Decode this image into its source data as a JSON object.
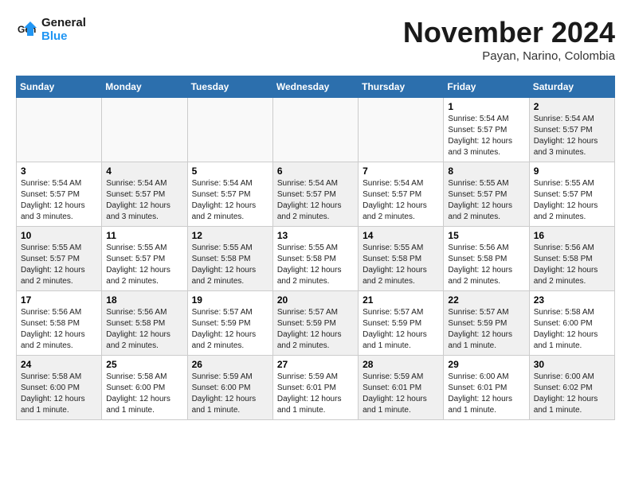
{
  "logo": {
    "line1": "General",
    "line2": "Blue"
  },
  "title": "November 2024",
  "location": "Payan, Narino, Colombia",
  "days_of_week": [
    "Sunday",
    "Monday",
    "Tuesday",
    "Wednesday",
    "Thursday",
    "Friday",
    "Saturday"
  ],
  "weeks": [
    [
      {
        "day": "",
        "info": "",
        "empty": true
      },
      {
        "day": "",
        "info": "",
        "empty": true
      },
      {
        "day": "",
        "info": "",
        "empty": true
      },
      {
        "day": "",
        "info": "",
        "empty": true
      },
      {
        "day": "",
        "info": "",
        "empty": true
      },
      {
        "day": "1",
        "info": "Sunrise: 5:54 AM\nSunset: 5:57 PM\nDaylight: 12 hours\nand 3 minutes."
      },
      {
        "day": "2",
        "info": "Sunrise: 5:54 AM\nSunset: 5:57 PM\nDaylight: 12 hours\nand 3 minutes.",
        "shaded": true
      }
    ],
    [
      {
        "day": "3",
        "info": "Sunrise: 5:54 AM\nSunset: 5:57 PM\nDaylight: 12 hours\nand 3 minutes."
      },
      {
        "day": "4",
        "info": "Sunrise: 5:54 AM\nSunset: 5:57 PM\nDaylight: 12 hours\nand 3 minutes.",
        "shaded": true
      },
      {
        "day": "5",
        "info": "Sunrise: 5:54 AM\nSunset: 5:57 PM\nDaylight: 12 hours\nand 2 minutes."
      },
      {
        "day": "6",
        "info": "Sunrise: 5:54 AM\nSunset: 5:57 PM\nDaylight: 12 hours\nand 2 minutes.",
        "shaded": true
      },
      {
        "day": "7",
        "info": "Sunrise: 5:54 AM\nSunset: 5:57 PM\nDaylight: 12 hours\nand 2 minutes."
      },
      {
        "day": "8",
        "info": "Sunrise: 5:55 AM\nSunset: 5:57 PM\nDaylight: 12 hours\nand 2 minutes.",
        "shaded": true
      },
      {
        "day": "9",
        "info": "Sunrise: 5:55 AM\nSunset: 5:57 PM\nDaylight: 12 hours\nand 2 minutes."
      }
    ],
    [
      {
        "day": "10",
        "info": "Sunrise: 5:55 AM\nSunset: 5:57 PM\nDaylight: 12 hours\nand 2 minutes.",
        "shaded": true
      },
      {
        "day": "11",
        "info": "Sunrise: 5:55 AM\nSunset: 5:57 PM\nDaylight: 12 hours\nand 2 minutes."
      },
      {
        "day": "12",
        "info": "Sunrise: 5:55 AM\nSunset: 5:58 PM\nDaylight: 12 hours\nand 2 minutes.",
        "shaded": true
      },
      {
        "day": "13",
        "info": "Sunrise: 5:55 AM\nSunset: 5:58 PM\nDaylight: 12 hours\nand 2 minutes."
      },
      {
        "day": "14",
        "info": "Sunrise: 5:55 AM\nSunset: 5:58 PM\nDaylight: 12 hours\nand 2 minutes.",
        "shaded": true
      },
      {
        "day": "15",
        "info": "Sunrise: 5:56 AM\nSunset: 5:58 PM\nDaylight: 12 hours\nand 2 minutes."
      },
      {
        "day": "16",
        "info": "Sunrise: 5:56 AM\nSunset: 5:58 PM\nDaylight: 12 hours\nand 2 minutes.",
        "shaded": true
      }
    ],
    [
      {
        "day": "17",
        "info": "Sunrise: 5:56 AM\nSunset: 5:58 PM\nDaylight: 12 hours\nand 2 minutes."
      },
      {
        "day": "18",
        "info": "Sunrise: 5:56 AM\nSunset: 5:58 PM\nDaylight: 12 hours\nand 2 minutes.",
        "shaded": true
      },
      {
        "day": "19",
        "info": "Sunrise: 5:57 AM\nSunset: 5:59 PM\nDaylight: 12 hours\nand 2 minutes."
      },
      {
        "day": "20",
        "info": "Sunrise: 5:57 AM\nSunset: 5:59 PM\nDaylight: 12 hours\nand 2 minutes.",
        "shaded": true
      },
      {
        "day": "21",
        "info": "Sunrise: 5:57 AM\nSunset: 5:59 PM\nDaylight: 12 hours\nand 1 minute."
      },
      {
        "day": "22",
        "info": "Sunrise: 5:57 AM\nSunset: 5:59 PM\nDaylight: 12 hours\nand 1 minute.",
        "shaded": true
      },
      {
        "day": "23",
        "info": "Sunrise: 5:58 AM\nSunset: 6:00 PM\nDaylight: 12 hours\nand 1 minute."
      }
    ],
    [
      {
        "day": "24",
        "info": "Sunrise: 5:58 AM\nSunset: 6:00 PM\nDaylight: 12 hours\nand 1 minute.",
        "shaded": true
      },
      {
        "day": "25",
        "info": "Sunrise: 5:58 AM\nSunset: 6:00 PM\nDaylight: 12 hours\nand 1 minute."
      },
      {
        "day": "26",
        "info": "Sunrise: 5:59 AM\nSunset: 6:00 PM\nDaylight: 12 hours\nand 1 minute.",
        "shaded": true
      },
      {
        "day": "27",
        "info": "Sunrise: 5:59 AM\nSunset: 6:01 PM\nDaylight: 12 hours\nand 1 minute."
      },
      {
        "day": "28",
        "info": "Sunrise: 5:59 AM\nSunset: 6:01 PM\nDaylight: 12 hours\nand 1 minute.",
        "shaded": true
      },
      {
        "day": "29",
        "info": "Sunrise: 6:00 AM\nSunset: 6:01 PM\nDaylight: 12 hours\nand 1 minute."
      },
      {
        "day": "30",
        "info": "Sunrise: 6:00 AM\nSunset: 6:02 PM\nDaylight: 12 hours\nand 1 minute.",
        "shaded": true
      }
    ]
  ]
}
